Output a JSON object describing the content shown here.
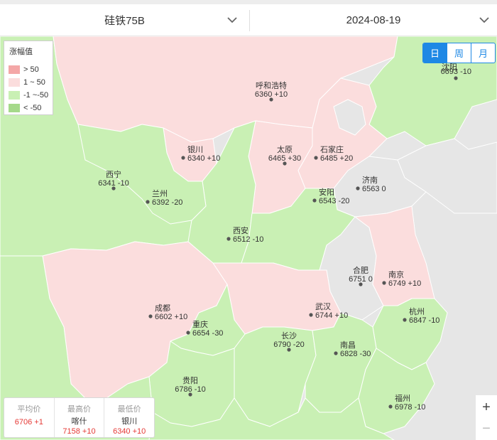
{
  "header": {
    "product": "硅铁75B",
    "date": "2024-08-19"
  },
  "legend": {
    "title": "涨幅值",
    "items": [
      {
        "label": "> 50",
        "color": "#f4a7a7"
      },
      {
        "label": "1 ~ 50",
        "color": "#fbdddd"
      },
      {
        "label": "-1 ~-50",
        "color": "#c9f0b4"
      },
      {
        "label": "< -50",
        "color": "#a5d98a"
      }
    ]
  },
  "period_toggle": {
    "day": "日",
    "week": "周",
    "month": "月",
    "active": "day"
  },
  "colors": {
    "up": "#fbdddd",
    "down": "#c9f0b4",
    "neutral": "#e6e6e6",
    "accent": "#1e88e5",
    "highlight_value": "#e53935"
  },
  "cities": [
    {
      "name": "沈阳",
      "value": "6693 -10",
      "trend": "down"
    },
    {
      "name": "呼和浩特",
      "value": "6360 +10",
      "trend": "up"
    },
    {
      "name": "银川",
      "value": "6340 +10",
      "trend": "up"
    },
    {
      "name": "太原",
      "value": "6465 +30",
      "trend": "up"
    },
    {
      "name": "石家庄",
      "value": "6485 +20",
      "trend": "up"
    },
    {
      "name": "西宁",
      "value": "6341 -10",
      "trend": "down"
    },
    {
      "name": "济南",
      "value": "6563 0",
      "trend": "flat"
    },
    {
      "name": "兰州",
      "value": "6392 -20",
      "trend": "down"
    },
    {
      "name": "安阳",
      "value": "6543 -20",
      "trend": "down"
    },
    {
      "name": "西安",
      "value": "6512 -10",
      "trend": "down"
    },
    {
      "name": "合肥",
      "value": "6751 0",
      "trend": "flat"
    },
    {
      "name": "南京",
      "value": "6749 +10",
      "trend": "up"
    },
    {
      "name": "成都",
      "value": "6602 +10",
      "trend": "up"
    },
    {
      "name": "武汉",
      "value": "6744 +10",
      "trend": "up"
    },
    {
      "name": "杭州",
      "value": "6847 -10",
      "trend": "down"
    },
    {
      "name": "重庆",
      "value": "6654 -30",
      "trend": "down"
    },
    {
      "name": "长沙",
      "value": "6790 -20",
      "trend": "down"
    },
    {
      "name": "南昌",
      "value": "6828 -30",
      "trend": "down"
    },
    {
      "name": "贵阳",
      "value": "6786 -10",
      "trend": "down"
    },
    {
      "name": "福州",
      "value": "6978 -10",
      "trend": "down"
    }
  ],
  "stats": {
    "avg": {
      "label": "平均价",
      "value": "6706 +1"
    },
    "max": {
      "label": "最高价",
      "city": "喀什",
      "value": "7158 +10"
    },
    "min": {
      "label": "最低价",
      "city": "银川",
      "value": "6340 +10"
    }
  },
  "zoom": {
    "in": "+",
    "out": "−"
  }
}
